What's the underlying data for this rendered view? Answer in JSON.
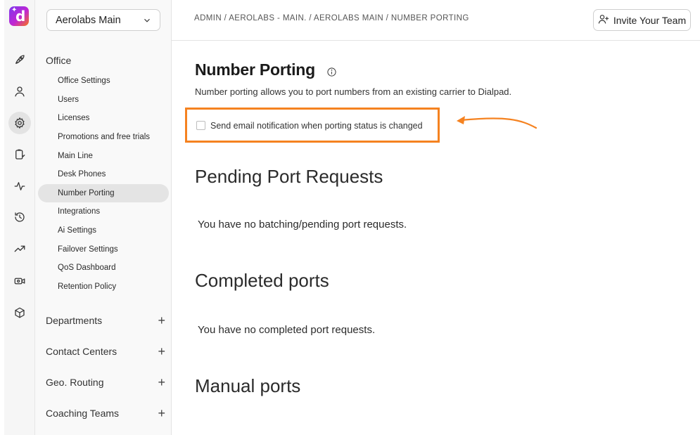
{
  "app": {
    "logo_letter": "d",
    "brand_colors": {
      "logo_start": "#7c3aed",
      "logo_mid": "#c026d3",
      "logo_end": "#f97316",
      "highlight": "#f58220"
    }
  },
  "rail": {
    "icons": [
      "rocket-icon",
      "user-icon",
      "gear-icon",
      "clipboard-icon",
      "activity-icon",
      "history-icon",
      "trending-icon",
      "video-icon",
      "cube-icon"
    ],
    "active": "gear-icon"
  },
  "nav": {
    "workspace": "Aerolabs Main",
    "section_title": "Office",
    "items": [
      {
        "label": "Office Settings"
      },
      {
        "label": "Users"
      },
      {
        "label": "Licenses"
      },
      {
        "label": "Promotions and free trials"
      },
      {
        "label": "Main Line"
      },
      {
        "label": "Desk Phones"
      },
      {
        "label": "Number Porting",
        "active": true
      },
      {
        "label": "Integrations"
      },
      {
        "label": "Ai Settings"
      },
      {
        "label": "Failover Settings"
      },
      {
        "label": "QoS Dashboard"
      },
      {
        "label": "Retention Policy"
      }
    ],
    "groups": [
      {
        "label": "Departments"
      },
      {
        "label": "Contact Centers"
      },
      {
        "label": "Geo. Routing"
      },
      {
        "label": "Coaching Teams"
      }
    ]
  },
  "header": {
    "breadcrumb": "ADMIN / AEROLABS - MAIN. / AEROLABS MAIN / NUMBER PORTING",
    "invite_label": "Invite Your Team"
  },
  "main": {
    "title": "Number Porting",
    "subtitle": "Number porting allows you to port numbers from an existing carrier to Dialpad.",
    "email_checkbox_label": "Send email notification when porting status is changed",
    "email_checkbox_checked": false,
    "pending_heading": "Pending Port Requests",
    "pending_empty": "You have no batching/pending port requests.",
    "completed_heading": "Completed ports",
    "completed_empty": "You have no completed port requests.",
    "manual_heading": "Manual ports"
  }
}
